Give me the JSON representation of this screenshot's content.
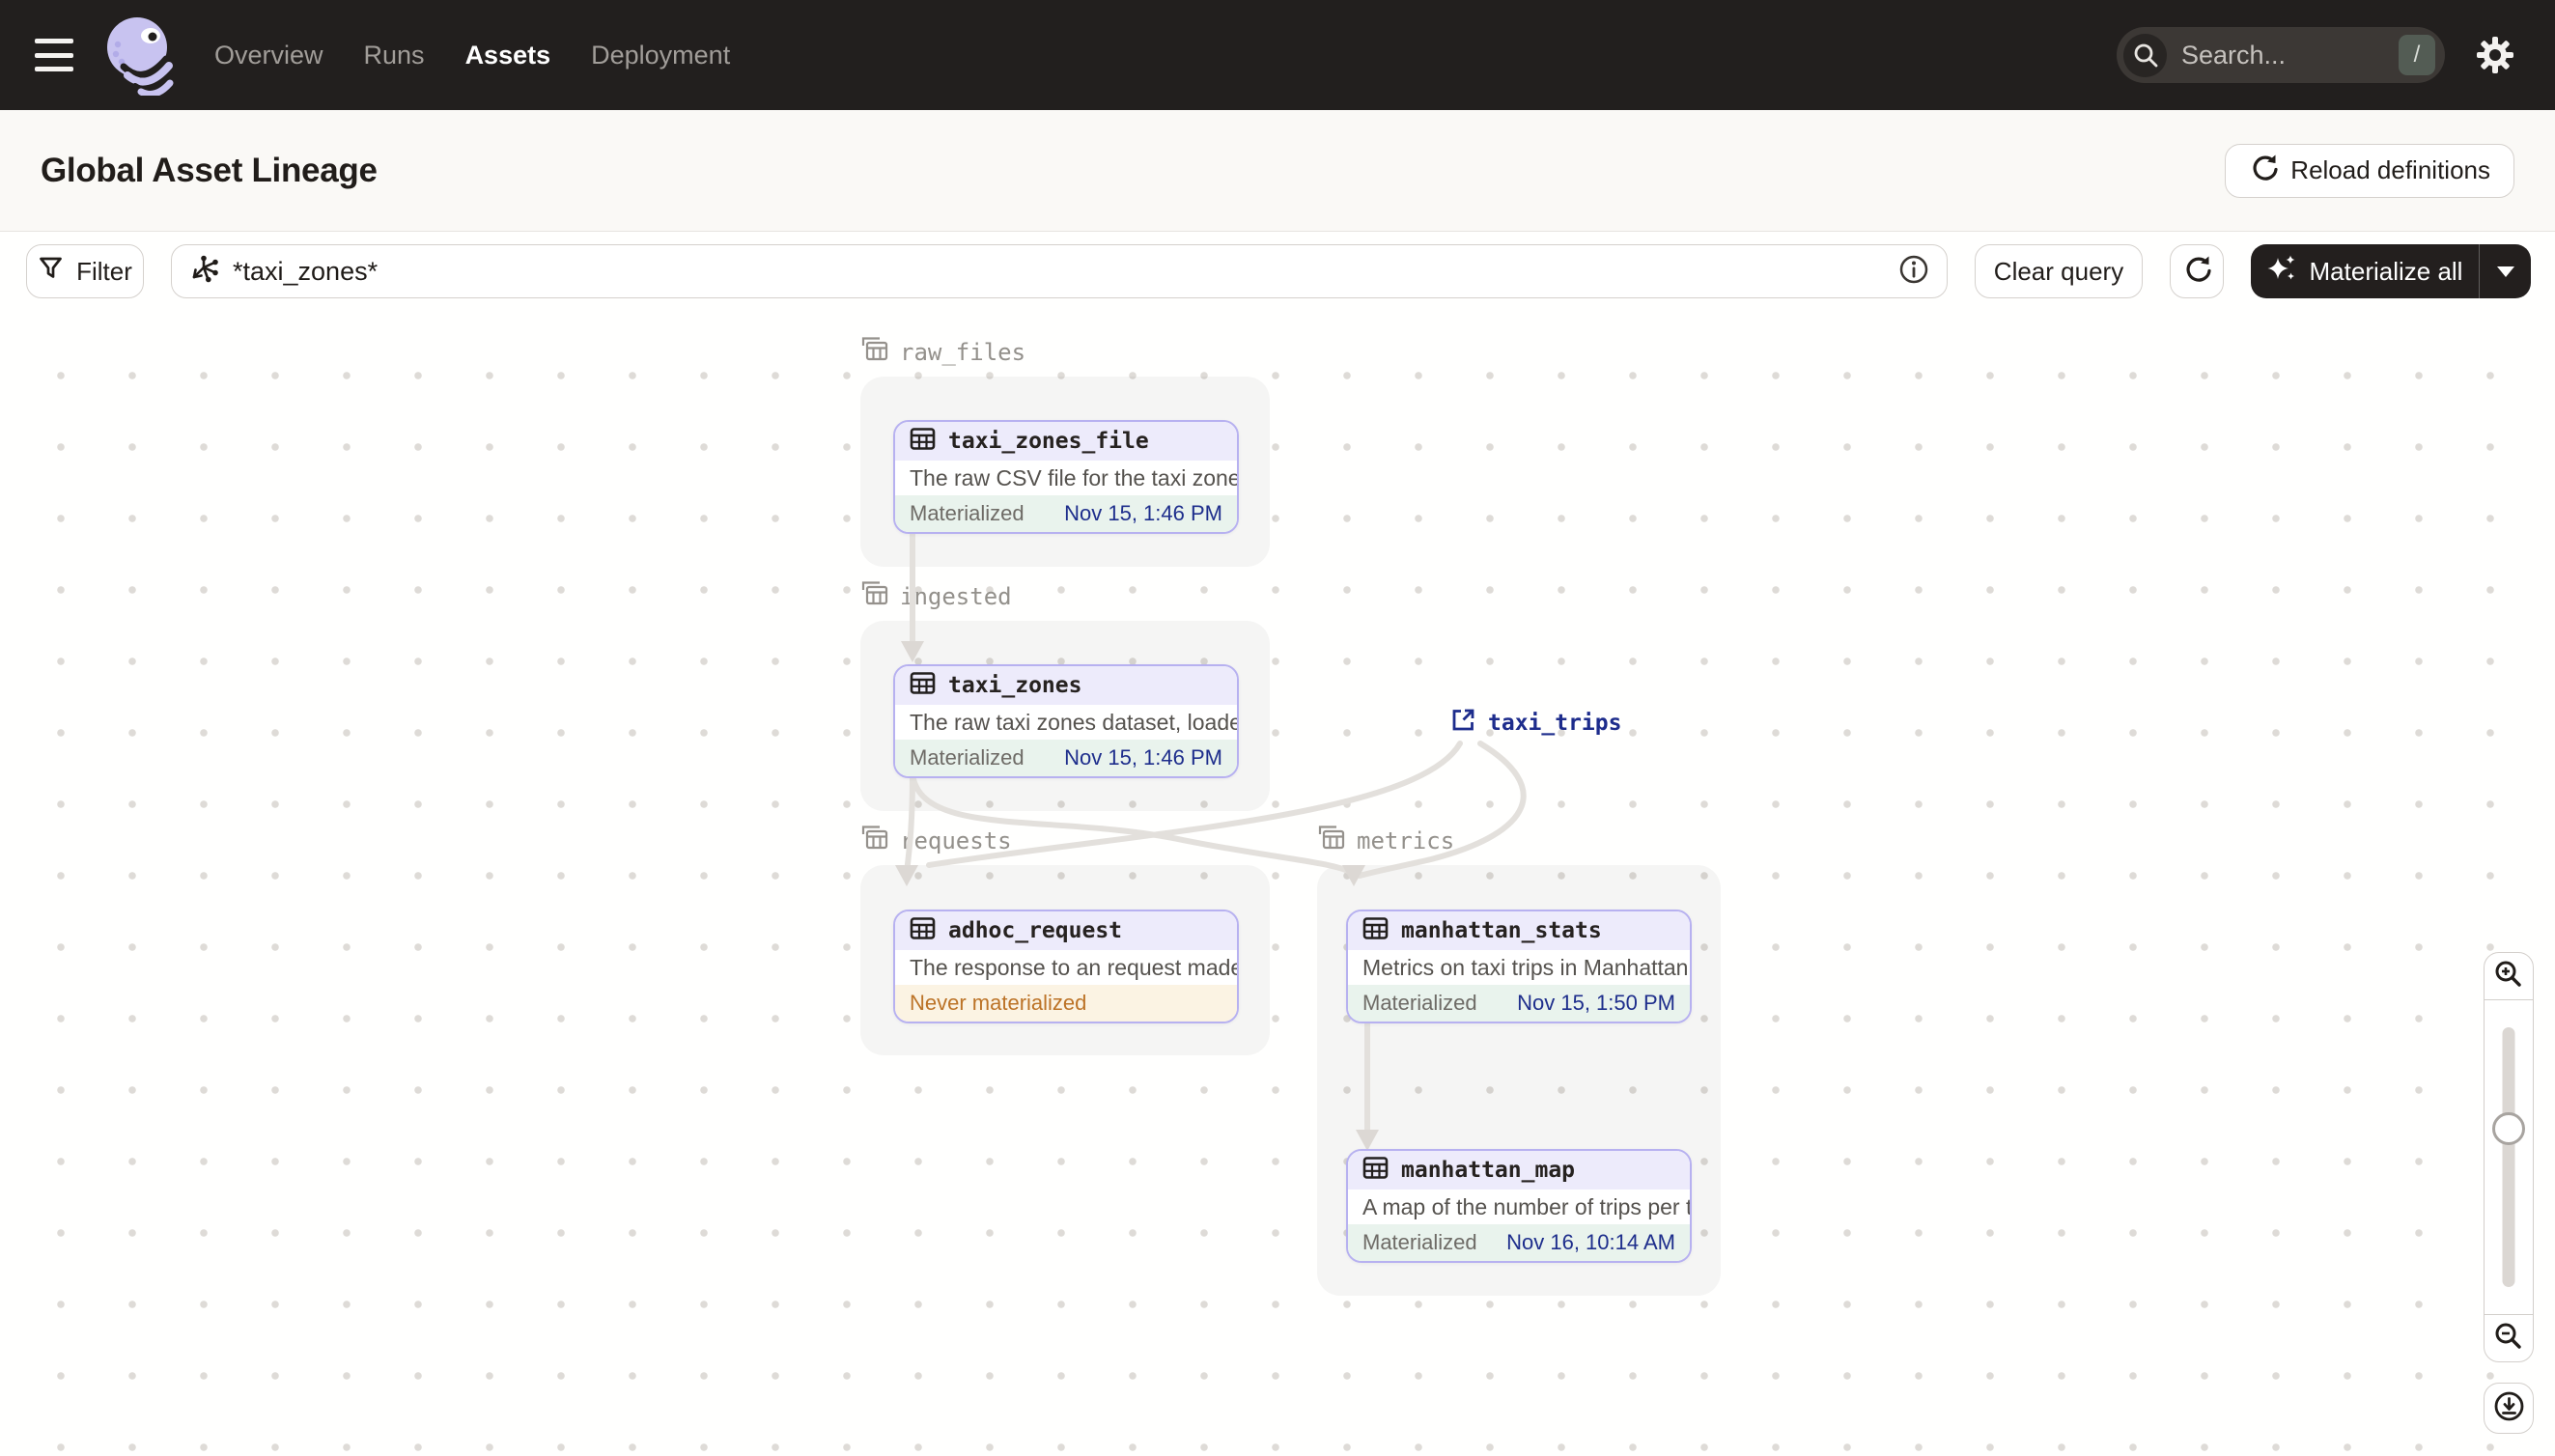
{
  "nav": {
    "items": [
      {
        "label": "Overview",
        "active": false
      },
      {
        "label": "Runs",
        "active": false
      },
      {
        "label": "Assets",
        "active": true
      },
      {
        "label": "Deployment",
        "active": false
      }
    ],
    "search": {
      "placeholder": "Search...",
      "shortcut": "/"
    }
  },
  "header": {
    "title": "Global Asset Lineage",
    "reload_button": "Reload definitions"
  },
  "toolbar": {
    "filter_button": "Filter",
    "query_value": "*taxi_zones*",
    "clear_button": "Clear query",
    "materialize_button": "Materialize all"
  },
  "graph": {
    "groups": [
      {
        "name": "raw_files"
      },
      {
        "name": "ingested"
      },
      {
        "name": "requests"
      },
      {
        "name": "metrics"
      }
    ],
    "nodes": [
      {
        "name": "taxi_zones_file",
        "group": "raw_files",
        "description": "The raw CSV file for the taxi zones dat...",
        "status": "Materialized",
        "timestamp": "Nov 15, 1:46 PM"
      },
      {
        "name": "taxi_zones",
        "group": "ingested",
        "description": "The raw taxi zones dataset, loaded int...",
        "status": "Materialized",
        "timestamp": "Nov 15, 1:46 PM"
      },
      {
        "name": "adhoc_request",
        "group": "requests",
        "description": "The response to an request made in th...",
        "status": "Never materialized",
        "timestamp": ""
      },
      {
        "name": "manhattan_stats",
        "group": "metrics",
        "description": "Metrics on taxi trips in Manhattan",
        "status": "Materialized",
        "timestamp": "Nov 15, 1:50 PM"
      },
      {
        "name": "manhattan_map",
        "group": "metrics",
        "description": "A map of the number of trips per taxi z...",
        "status": "Materialized",
        "timestamp": "Nov 16, 10:14 AM"
      }
    ],
    "external_assets": [
      {
        "name": "taxi_trips"
      }
    ],
    "edges": [
      {
        "from": "taxi_zones_file",
        "to": "taxi_zones"
      },
      {
        "from": "taxi_zones",
        "to": "adhoc_request"
      },
      {
        "from": "taxi_zones",
        "to": "manhattan_stats"
      },
      {
        "from": "taxi_trips",
        "to": "adhoc_request"
      },
      {
        "from": "taxi_trips",
        "to": "manhattan_stats"
      },
      {
        "from": "manhattan_stats",
        "to": "manhattan_map"
      }
    ]
  },
  "colors": {
    "nav_bg": "#221F1E",
    "logo_lavender": "#C8C3F0",
    "node_border": "#B7B1F0",
    "node_header_bg": "#EDEBFB",
    "materialized_bg": "#E9F3ED",
    "timestamp_text": "#1E2E8C",
    "never_materialized_bg": "#FBF3E3",
    "never_materialized_text": "#BC7327",
    "edge": "#E3E0DC"
  },
  "icons": [
    "menu-icon",
    "dagster-logo",
    "search-icon",
    "gear-icon",
    "refresh-icon",
    "filter-icon",
    "asset-graph-query-icon",
    "info-icon",
    "sparkle-icon",
    "caret-down-icon",
    "table-icon",
    "group-tables-icon",
    "external-link-icon",
    "zoom-in-icon",
    "zoom-out-icon",
    "download-icon"
  ]
}
